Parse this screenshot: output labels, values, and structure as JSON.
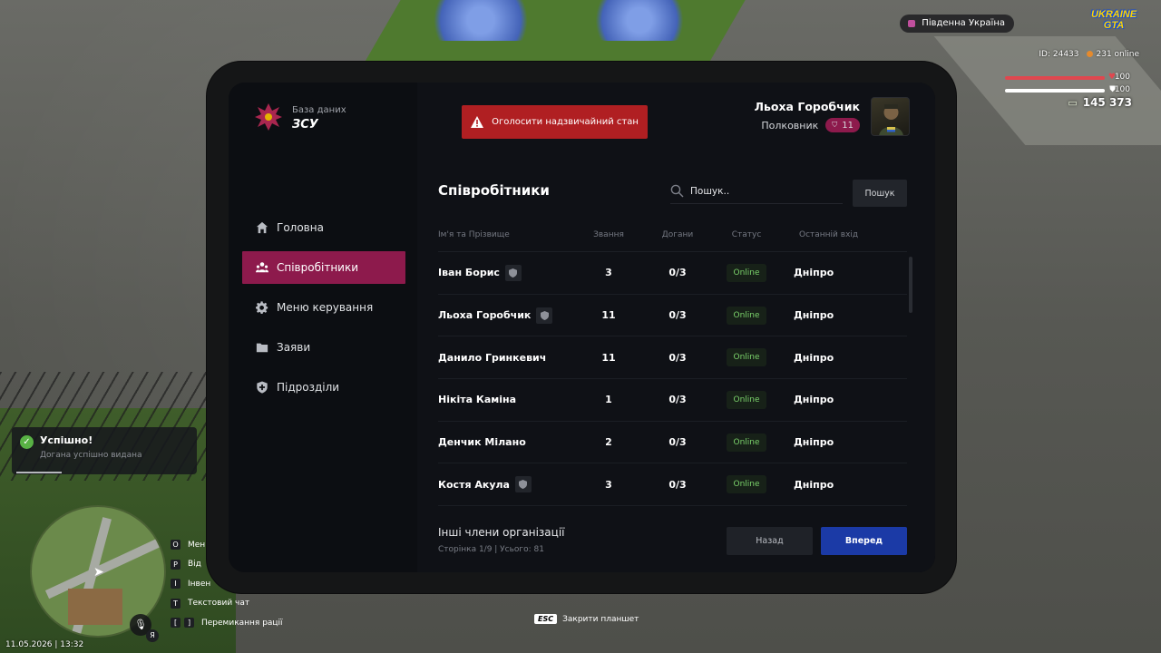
{
  "app": {
    "subtitle": "База даних",
    "title": "ЗСУ"
  },
  "emergency_button": {
    "label": "Оголосити надзвичайний стан"
  },
  "profile": {
    "name": "Льоха Горобчик",
    "rank": "Полковник",
    "rank_level": "11"
  },
  "nav": {
    "items": [
      {
        "label": "Головна",
        "icon": "home-icon",
        "active": false
      },
      {
        "label": "Співробітники",
        "icon": "users-icon",
        "active": true
      },
      {
        "label": "Меню керування",
        "icon": "gear-icon",
        "active": false
      },
      {
        "label": "Заяви",
        "icon": "folder-icon",
        "active": false
      },
      {
        "label": "Підрозділи",
        "icon": "shield-plus-icon",
        "active": false
      }
    ]
  },
  "employees": {
    "title": "Співробітники",
    "search": {
      "placeholder": "Пошук..",
      "button": "Пошук"
    },
    "columns": [
      "Ім'я та Прізвище",
      "Звання",
      "Догани",
      "Статус",
      "Останній вхід"
    ],
    "rows": [
      {
        "name": "Іван Борис",
        "badge": true,
        "rank": "3",
        "warnings": "0/3",
        "status": "Online",
        "last_login": "Дніпро"
      },
      {
        "name": "Льоха Горобчик",
        "badge": true,
        "rank": "11",
        "warnings": "0/3",
        "status": "Online",
        "last_login": "Дніпро"
      },
      {
        "name": "Данило Гринкевич",
        "badge": false,
        "rank": "11",
        "warnings": "0/3",
        "status": "Online",
        "last_login": "Дніпро"
      },
      {
        "name": "Нікіта Каміна",
        "badge": false,
        "rank": "1",
        "warnings": "0/3",
        "status": "Online",
        "last_login": "Дніпро"
      },
      {
        "name": "Денчик Мілано",
        "badge": false,
        "rank": "2",
        "warnings": "0/3",
        "status": "Online",
        "last_login": "Дніпро"
      },
      {
        "name": "Костя Акула",
        "badge": true,
        "rank": "3",
        "warnings": "0/3",
        "status": "Online",
        "last_login": "Дніпро"
      }
    ],
    "footer": {
      "title": "Інші члени організації",
      "pagination": "Сторінка 1/9 | Усього: 81",
      "back": "Назад",
      "next": "Вперед"
    }
  },
  "hud": {
    "region": "Південна Україна",
    "logo_line1": "UKRAINE",
    "logo_line2": "GTA",
    "player_id": "ID: 24433",
    "online": "231 online",
    "health": "100",
    "armor": "100",
    "money": "145 373",
    "toast_title": "Успішно!",
    "toast_text": "Догана успішно видана",
    "keys": [
      {
        "keys": [
          "O"
        ],
        "label": "Мен"
      },
      {
        "keys": [
          "P"
        ],
        "label": "Від"
      },
      {
        "keys": [
          "I"
        ],
        "label": "Інвен"
      },
      {
        "keys": [
          "T"
        ],
        "label": "Текстовий чат"
      },
      {
        "keys": [
          "[",
          "]"
        ],
        "label": "Перемикання рації"
      }
    ],
    "mic_badge": "Я",
    "datetime": "11.05.2026 | 13:32",
    "esc_key": "ESC",
    "esc_label": "Закрити планшет"
  },
  "colors": {
    "accent": "#8d1a4c",
    "emergency": "#b01f22",
    "primary_button": "#1b3aa6",
    "online": "#7bd26b"
  }
}
